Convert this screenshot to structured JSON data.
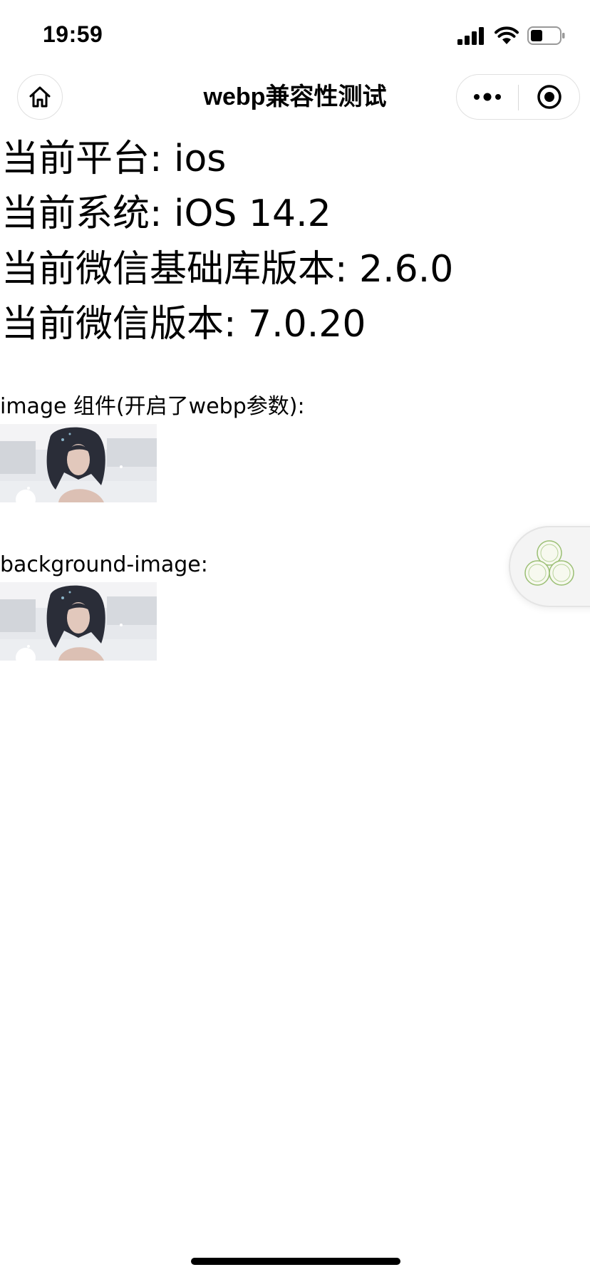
{
  "status_bar": {
    "time": "19:59"
  },
  "nav": {
    "title": "webp兼容性测试",
    "icons": {
      "home": "home-icon",
      "more": "more-dots-icon",
      "close": "target-circle-icon"
    }
  },
  "info": {
    "platform": "当前平台: ios",
    "system": "当前系统: iOS 14.2",
    "sdk_version": "当前微信基础库版本: 2.6.0",
    "wechat_version": "当前微信版本: 7.0.20"
  },
  "sections": {
    "image_component_label": "image 组件(开启了webp参数):",
    "background_image_label": "background-image:"
  },
  "colors": {
    "background": "#ffffff",
    "text": "#000000",
    "capsule_border": "#e0e0e0",
    "widget_bg": "#f4f4f4"
  }
}
